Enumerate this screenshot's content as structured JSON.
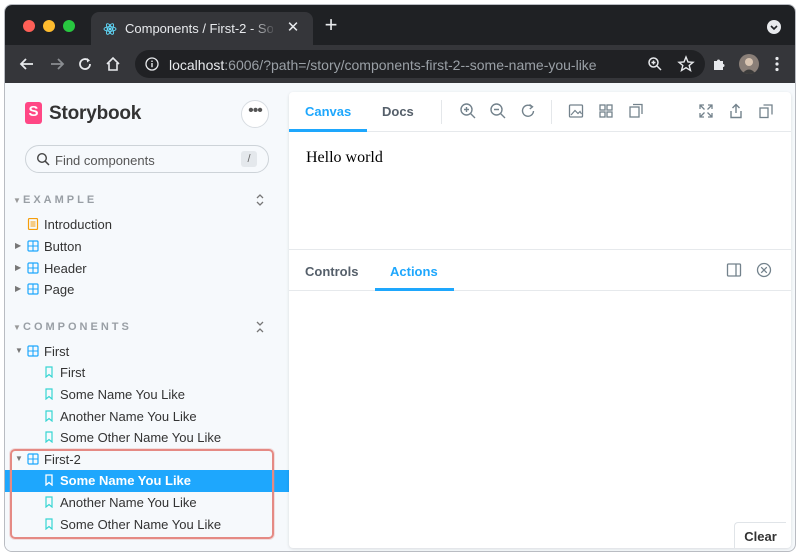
{
  "browser": {
    "tab_title": "Components / First-2 - Some Name You Like",
    "tab_close": "✕",
    "new_tab": "+",
    "url_host": "localhost",
    "url_rest": ":6006/?path=/story/components-first-2--some-name-you-like"
  },
  "sidebar": {
    "brand": "Storybook",
    "brand_letter": "S",
    "menu_label": "•••",
    "search_placeholder": "Find components",
    "search_shortcut": "/",
    "sections": [
      {
        "title": "EXAMPLE",
        "items": [
          {
            "label": "Introduction",
            "icon": "document-icon"
          },
          {
            "label": "Button",
            "icon": "component-icon"
          },
          {
            "label": "Header",
            "icon": "component-icon"
          },
          {
            "label": "Page",
            "icon": "component-icon"
          }
        ]
      },
      {
        "title": "COMPONENTS",
        "groups": [
          {
            "label": "First",
            "stories": [
              "First",
              "Some Name You Like",
              "Another Name You Like",
              "Some Other Name You Like"
            ]
          },
          {
            "label": "First-2",
            "stories": [
              "Some Name You Like",
              "Another Name You Like",
              "Some Other Name You Like"
            ]
          }
        ]
      }
    ]
  },
  "preview": {
    "tabs": [
      "Canvas",
      "Docs"
    ],
    "active_tab": "Canvas",
    "content": "Hello world"
  },
  "addons": {
    "tabs": [
      "Controls",
      "Actions"
    ],
    "active_tab": "Actions",
    "clear_label": "Clear"
  },
  "colors": {
    "accent": "#1ea7fd",
    "brand": "#ff4785",
    "highlight": "#e58a84"
  }
}
